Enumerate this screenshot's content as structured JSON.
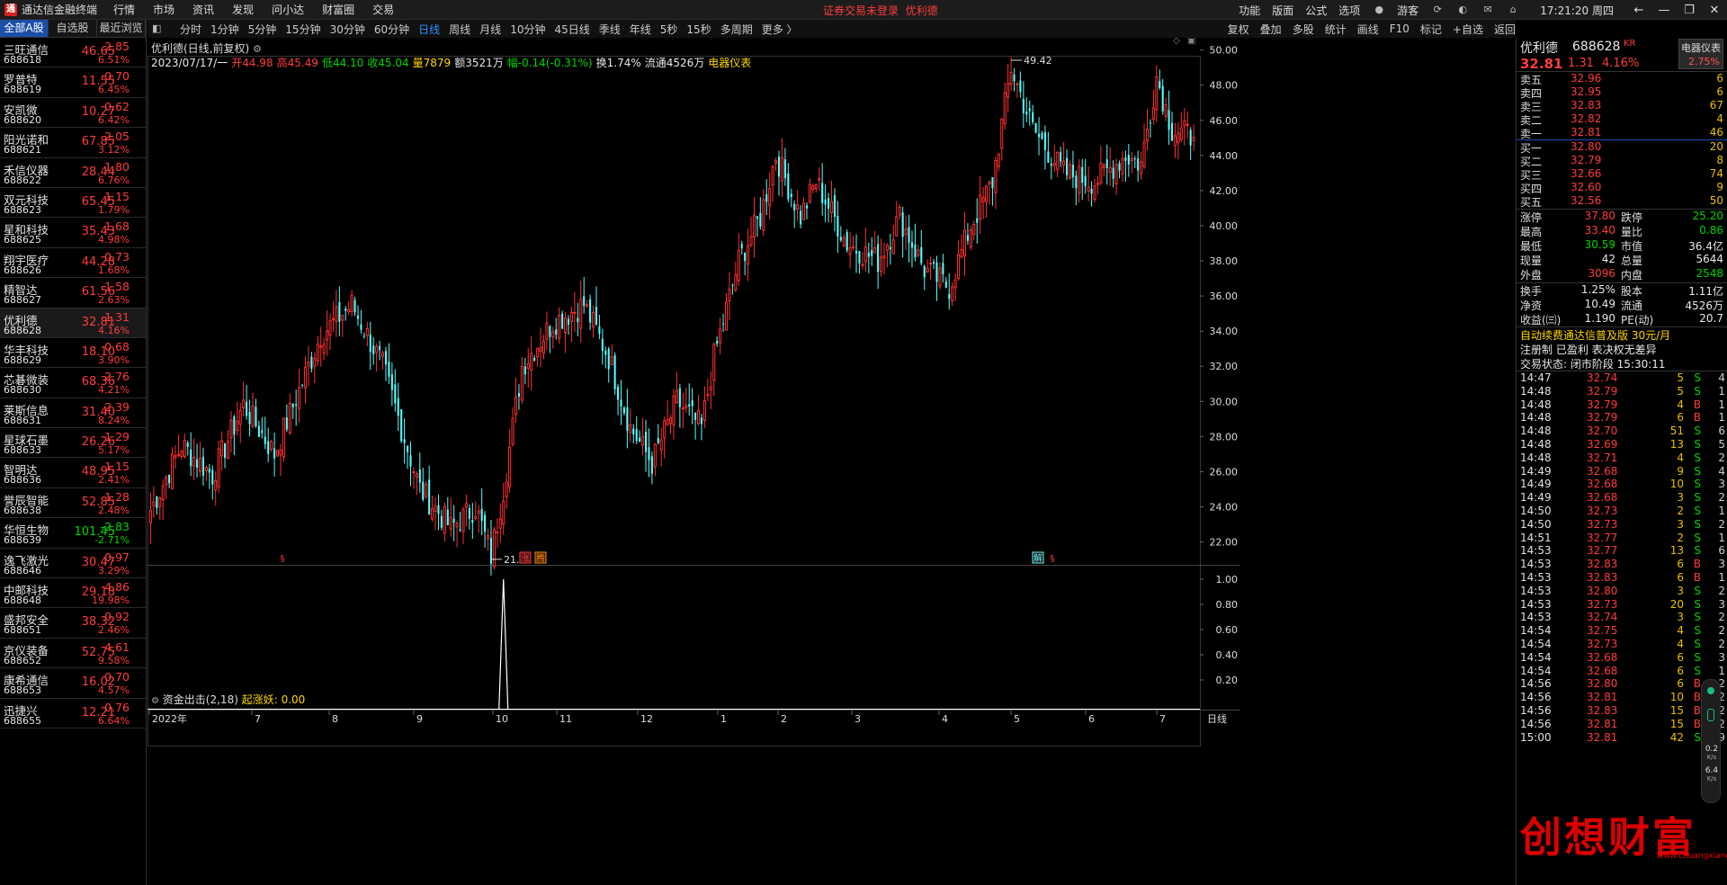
{
  "app": {
    "title": "通达信金融终端",
    "menu": [
      "行情",
      "市场",
      "资讯",
      "发现",
      "问小达",
      "财富圈",
      "交易"
    ],
    "login_warning": "证券交易未登录",
    "login_stock": "优利德",
    "right_menu": [
      "功能",
      "版面",
      "公式",
      "选项"
    ],
    "user": "游客",
    "clock": "17:21:20 周四"
  },
  "left": {
    "tabs": [
      "全部A股",
      "自选股",
      "最近浏览"
    ],
    "stocks": [
      {
        "name": "三旺通信",
        "code": "688618",
        "price": "46.65",
        "chg": "2.85",
        "pct": "6.51%",
        "dir": "up"
      },
      {
        "name": "罗普特",
        "code": "688619",
        "price": "11.55",
        "chg": "0.70",
        "pct": "6.45%",
        "dir": "up"
      },
      {
        "name": "安凯微",
        "code": "688620",
        "price": "10.27",
        "chg": "0.62",
        "pct": "6.42%",
        "dir": "up"
      },
      {
        "name": "阳光诺和",
        "code": "688621",
        "price": "67.85",
        "chg": "2.05",
        "pct": "3.12%",
        "dir": "up"
      },
      {
        "name": "禾信仪器",
        "code": "688622",
        "price": "28.44",
        "chg": "1.80",
        "pct": "6.76%",
        "dir": "up"
      },
      {
        "name": "双元科技",
        "code": "688623",
        "price": "65.45",
        "chg": "1.15",
        "pct": "1.79%",
        "dir": "up"
      },
      {
        "name": "星和科技",
        "code": "688625",
        "price": "35.43",
        "chg": "1.68",
        "pct": "4.98%",
        "dir": "up"
      },
      {
        "name": "翔宇医疗",
        "code": "688626",
        "price": "44.28",
        "chg": "0.73",
        "pct": "1.68%",
        "dir": "up"
      },
      {
        "name": "精智达",
        "code": "688627",
        "price": "61.56",
        "chg": "1.58",
        "pct": "2.63%",
        "dir": "up"
      },
      {
        "name": "优利德",
        "code": "688628",
        "price": "32.81",
        "chg": "1.31",
        "pct": "4.16%",
        "dir": "up",
        "selected": true
      },
      {
        "name": "华丰科技",
        "code": "688629",
        "price": "18.10",
        "chg": "0.68",
        "pct": "3.90%",
        "dir": "up"
      },
      {
        "name": "芯碁微装",
        "code": "688630",
        "price": "68.36",
        "chg": "2.76",
        "pct": "4.21%",
        "dir": "up"
      },
      {
        "name": "莱斯信息",
        "code": "688631",
        "price": "31.40",
        "chg": "2.39",
        "pct": "8.24%",
        "dir": "up"
      },
      {
        "name": "星球石墨",
        "code": "688633",
        "price": "26.26",
        "chg": "1.29",
        "pct": "5.17%",
        "dir": "up"
      },
      {
        "name": "智明达",
        "code": "688636",
        "price": "48.95",
        "chg": "1.15",
        "pct": "2.41%",
        "dir": "up"
      },
      {
        "name": "誉辰智能",
        "code": "688638",
        "price": "52.85",
        "chg": "1.28",
        "pct": "2.48%",
        "dir": "up"
      },
      {
        "name": "华恒生物",
        "code": "688639",
        "price": "101.45",
        "chg": "-2.83",
        "pct": "-2.71%",
        "dir": "down"
      },
      {
        "name": "逸飞激光",
        "code": "688646",
        "price": "30.47",
        "chg": "0.97",
        "pct": "3.29%",
        "dir": "up"
      },
      {
        "name": "中邮科技",
        "code": "688648",
        "price": "29.18",
        "chg": "4.86",
        "pct": "19.98%",
        "dir": "up"
      },
      {
        "name": "盛邦安全",
        "code": "688651",
        "price": "38.32",
        "chg": "0.92",
        "pct": "2.46%",
        "dir": "up"
      },
      {
        "name": "京仪装备",
        "code": "688652",
        "price": "52.75",
        "chg": "4.61",
        "pct": "9.58%",
        "dir": "up"
      },
      {
        "name": "康希通信",
        "code": "688653",
        "price": "16.02",
        "chg": "0.70",
        "pct": "4.57%",
        "dir": "up"
      },
      {
        "name": "迅捷兴",
        "code": "688655",
        "price": "12.21",
        "chg": "0.76",
        "pct": "6.64%",
        "dir": "up"
      }
    ]
  },
  "toolbar": {
    "periods": [
      "分时",
      "1分钟",
      "5分钟",
      "15分钟",
      "30分钟",
      "60分钟",
      "日线",
      "周线",
      "月线",
      "10分钟",
      "45日线",
      "季线",
      "年线",
      "5秒",
      "15秒",
      "多周期",
      "更多 〉"
    ],
    "active": "日线",
    "right": [
      "复权",
      "叠加",
      "多股",
      "统计",
      "画线",
      "F10",
      "标记",
      "+自选",
      "返回"
    ]
  },
  "chart_header": {
    "title": "优利德(日线,前复权)",
    "date": "2023/07/17/一",
    "open": "开44.98",
    "high": "高45.49",
    "low": "低44.10",
    "close": "收45.04",
    "vol": "量7879",
    "amount": "额3521万",
    "change": "幅-0.14(-0.31%)",
    "turnover": "换1.74%",
    "float": "流通4526万",
    "meter": "电器仪表"
  },
  "indicator": {
    "title": "资金出击(2,18)",
    "value": "起涨妖: 0.00"
  },
  "chart_data": {
    "type": "candlestick",
    "y_ticks": [
      "50.00",
      "48.00",
      "46.00",
      "44.00",
      "42.00",
      "40.00",
      "38.00",
      "36.00",
      "34.00",
      "32.00",
      "30.00",
      "28.00",
      "26.00",
      "24.00",
      "22.00"
    ],
    "ylim": [
      20.8,
      50.7
    ],
    "x_labels": [
      "2022年",
      "7",
      "8",
      "9",
      "10",
      "11",
      "12",
      "1",
      "2",
      "3",
      "4",
      "5",
      "6",
      "7"
    ],
    "annotations": {
      "high": "49.42",
      "low": "21.01"
    },
    "markers": [
      "§",
      "涨",
      "腾",
      "解",
      "§"
    ],
    "anchors": [
      [
        0,
        23.8
      ],
      [
        10,
        27.5
      ],
      [
        20,
        25.8
      ],
      [
        30,
        29.8
      ],
      [
        40,
        27.0
      ],
      [
        55,
        33.8
      ],
      [
        65,
        35.5
      ],
      [
        75,
        32.0
      ],
      [
        87,
        25.0
      ],
      [
        97,
        22.8
      ],
      [
        105,
        24.0
      ],
      [
        110,
        21.2
      ],
      [
        114,
        25.0
      ],
      [
        120,
        32.0
      ],
      [
        130,
        34.5
      ],
      [
        140,
        35.5
      ],
      [
        148,
        32.5
      ],
      [
        155,
        28.5
      ],
      [
        162,
        26.5
      ],
      [
        170,
        30.0
      ],
      [
        178,
        28.5
      ],
      [
        182,
        32.5
      ],
      [
        190,
        38.0
      ],
      [
        197,
        40.5
      ],
      [
        202,
        44.0
      ],
      [
        210,
        40.5
      ],
      [
        215,
        42.5
      ],
      [
        225,
        39.0
      ],
      [
        235,
        38.0
      ],
      [
        242,
        40.5
      ],
      [
        250,
        37.5
      ],
      [
        258,
        36.5
      ],
      [
        265,
        40.0
      ],
      [
        272,
        42.5
      ],
      [
        278,
        49.0
      ],
      [
        285,
        45.5
      ],
      [
        295,
        43.0
      ],
      [
        305,
        42.5
      ],
      [
        315,
        44.0
      ],
      [
        320,
        43.5
      ],
      [
        325,
        48.5
      ],
      [
        330,
        45.5
      ],
      [
        337,
        45.04
      ]
    ],
    "y_ticks_sub": [
      "1.00",
      "0.80",
      "0.60",
      "0.40",
      "0.20"
    ],
    "sub_ylim": [
      0,
      1
    ],
    "sub_spike": 1.0,
    "date_label": "日线"
  },
  "quote": {
    "name": "优利德",
    "code": "688628",
    "kr": "KR",
    "price": "32.81",
    "chg": "1.31",
    "pct": "4.16%",
    "meter_label": "电器仪表",
    "meter_value": "2.75%",
    "sell": [
      {
        "label": "卖五",
        "price": "32.96",
        "vol": "6"
      },
      {
        "label": "卖四",
        "price": "32.95",
        "vol": "6"
      },
      {
        "label": "卖三",
        "price": "32.83",
        "vol": "67"
      },
      {
        "label": "卖二",
        "price": "32.82",
        "vol": "4"
      },
      {
        "label": "卖一",
        "price": "32.81",
        "vol": "46"
      }
    ],
    "buy": [
      {
        "label": "买一",
        "price": "32.80",
        "vol": "20"
      },
      {
        "label": "买二",
        "price": "32.79",
        "vol": "8"
      },
      {
        "label": "买三",
        "price": "32.66",
        "vol": "74"
      },
      {
        "label": "买四",
        "price": "32.60",
        "vol": "9"
      },
      {
        "label": "买五",
        "price": "32.56",
        "vol": "50"
      }
    ],
    "stats1": [
      {
        "l1": "涨停",
        "v1": "37.80",
        "c1": "up",
        "l2": "跌停",
        "v2": "25.20",
        "c2": "down"
      },
      {
        "l1": "最高",
        "v1": "33.40",
        "c1": "up",
        "l2": "量比",
        "v2": "0.86",
        "c2": "down"
      },
      {
        "l1": "最低",
        "v1": "30.59",
        "c1": "down",
        "l2": "市值",
        "v2": "36.4亿",
        "c2": "wht"
      },
      {
        "l1": "现量",
        "v1": "42",
        "c1": "wht",
        "l2": "总量",
        "v2": "5644",
        "c2": "wht"
      },
      {
        "l1": "外盘",
        "v1": "3096",
        "c1": "up",
        "l2": "内盘",
        "v2": "2548",
        "c2": "down"
      }
    ],
    "stats2": [
      {
        "l1": "换手",
        "v1": "1.25%",
        "c1": "wht",
        "l2": "股本",
        "v2": "1.11亿",
        "c2": "wht"
      },
      {
        "l1": "净资",
        "v1": "10.49",
        "c1": "wht",
        "l2": "流通",
        "v2": "4526万",
        "c2": "wht"
      },
      {
        "l1": "收益(㈢)",
        "v1": "1.190",
        "c1": "wht",
        "l2": "PE(动)",
        "v2": "20.7",
        "c2": "wht"
      }
    ],
    "promo": "自动续费通达信普及版  30元/月",
    "tags": "注册制  已盈利  表决权无差异",
    "status": "交易状态: 闭市阶段 15:30:11",
    "ticks": [
      {
        "t": "14:47",
        "p": "32.74",
        "v": "5",
        "d": "S",
        "n": "4"
      },
      {
        "t": "14:48",
        "p": "32.79",
        "v": "5",
        "d": "S",
        "n": "1"
      },
      {
        "t": "14:48",
        "p": "32.79",
        "v": "4",
        "d": "B",
        "n": "1"
      },
      {
        "t": "14:48",
        "p": "32.79",
        "v": "6",
        "d": "B",
        "n": "1"
      },
      {
        "t": "14:48",
        "p": "32.70",
        "v": "51",
        "d": "S",
        "n": "6"
      },
      {
        "t": "14:48",
        "p": "32.69",
        "v": "13",
        "d": "S",
        "n": "5"
      },
      {
        "t": "14:48",
        "p": "32.71",
        "v": "4",
        "d": "S",
        "n": "2"
      },
      {
        "t": "14:49",
        "p": "32.68",
        "v": "9",
        "d": "S",
        "n": "4"
      },
      {
        "t": "14:49",
        "p": "32.68",
        "v": "10",
        "d": "S",
        "n": "3"
      },
      {
        "t": "14:49",
        "p": "32.68",
        "v": "3",
        "d": "S",
        "n": "2"
      },
      {
        "t": "14:50",
        "p": "32.73",
        "v": "2",
        "d": "S",
        "n": "1"
      },
      {
        "t": "14:50",
        "p": "32.73",
        "v": "3",
        "d": "S",
        "n": "2"
      },
      {
        "t": "14:51",
        "p": "32.77",
        "v": "2",
        "d": "S",
        "n": "1"
      },
      {
        "t": "14:53",
        "p": "32.77",
        "v": "13",
        "d": "S",
        "n": "6"
      },
      {
        "t": "14:53",
        "p": "32.83",
        "v": "6",
        "d": "B",
        "n": "3"
      },
      {
        "t": "14:53",
        "p": "32.83",
        "v": "6",
        "d": "B",
        "n": "1"
      },
      {
        "t": "14:53",
        "p": "32.80",
        "v": "3",
        "d": "S",
        "n": "2"
      },
      {
        "t": "14:53",
        "p": "32.73",
        "v": "20",
        "d": "S",
        "n": "3"
      },
      {
        "t": "14:53",
        "p": "32.74",
        "v": "3",
        "d": "S",
        "n": "2"
      },
      {
        "t": "14:54",
        "p": "32.75",
        "v": "4",
        "d": "S",
        "n": "2"
      },
      {
        "t": "14:54",
        "p": "32.73",
        "v": "4",
        "d": "S",
        "n": "2"
      },
      {
        "t": "14:54",
        "p": "32.68",
        "v": "6",
        "d": "S",
        "n": "3"
      },
      {
        "t": "14:54",
        "p": "32.68",
        "v": "6",
        "d": "S",
        "n": "1"
      },
      {
        "t": "14:56",
        "p": "32.80",
        "v": "6",
        "d": "B",
        "n": "2"
      },
      {
        "t": "14:56",
        "p": "32.81",
        "v": "10",
        "d": "B",
        "n": "2"
      },
      {
        "t": "14:56",
        "p": "32.83",
        "v": "15",
        "d": "B",
        "n": "2"
      },
      {
        "t": "14:56",
        "p": "32.81",
        "v": "15",
        "d": "B",
        "n": "2"
      },
      {
        "t": "15:00",
        "p": "32.81",
        "v": "42",
        "d": "S",
        "n": "9"
      }
    ]
  },
  "speed": {
    "v1": "0.2",
    "u1": "K/s",
    "v2": "6.4",
    "u2": "K/s"
  },
  "watermark": {
    "text": "创想财富",
    "url": "www.chuangxiang.com"
  },
  "colors": {
    "up": "#ff3c3c",
    "down": "#00d400",
    "candle_up": "#ff3030",
    "candle_down": "#54ffff",
    "grid": "#2b2b2b",
    "accent": "#1b4fa8"
  }
}
